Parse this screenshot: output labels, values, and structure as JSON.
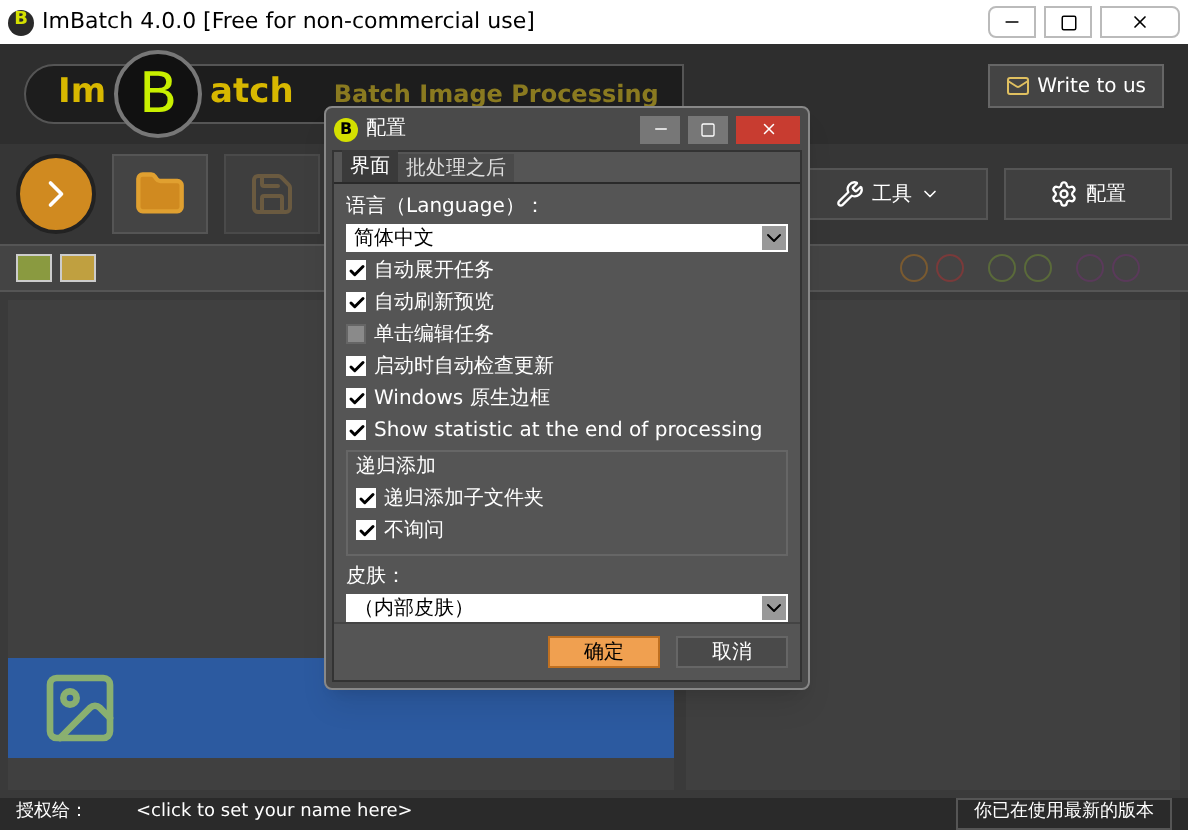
{
  "window": {
    "icon_letter": "B",
    "title": "ImBatch 4.0.0 [Free for non-commercial use]"
  },
  "header": {
    "logo_left": "Im",
    "logo_letter": "B",
    "logo_right": "atch",
    "tagline": "Batch Image Processing",
    "write_button": "Write to us"
  },
  "toolbar": {
    "tools_button": "工具",
    "settings_button": "配置"
  },
  "dialog": {
    "icon_letter": "B",
    "title": "配置",
    "tabs": [
      {
        "label": "界面",
        "selected": true
      },
      {
        "label": "批处理之后",
        "selected": false
      }
    ],
    "language_label": "语言（Language）：",
    "language_value": "简体中文",
    "options": [
      {
        "label": "自动展开任务",
        "checked": true
      },
      {
        "label": "自动刷新预览",
        "checked": true
      },
      {
        "label": "单击编辑任务",
        "checked": false
      },
      {
        "label": "启动时自动检查更新",
        "checked": true
      },
      {
        "label": "Windows 原生边框",
        "checked": true
      },
      {
        "label": "Show statistic at the end of processing",
        "checked": true
      }
    ],
    "group_title": "递归添加",
    "group_options": [
      {
        "label": "递归添加子文件夹",
        "checked": true
      },
      {
        "label": "不询问",
        "checked": true
      }
    ],
    "skin_label": "皮肤：",
    "skin_value": "（内部皮肤）",
    "ok_button": "确定",
    "cancel_button": "取消"
  },
  "status_bar": {
    "label": "授权给：",
    "name_link": "<click to set your name here>",
    "update_status": "你已在使用最新的版本"
  }
}
